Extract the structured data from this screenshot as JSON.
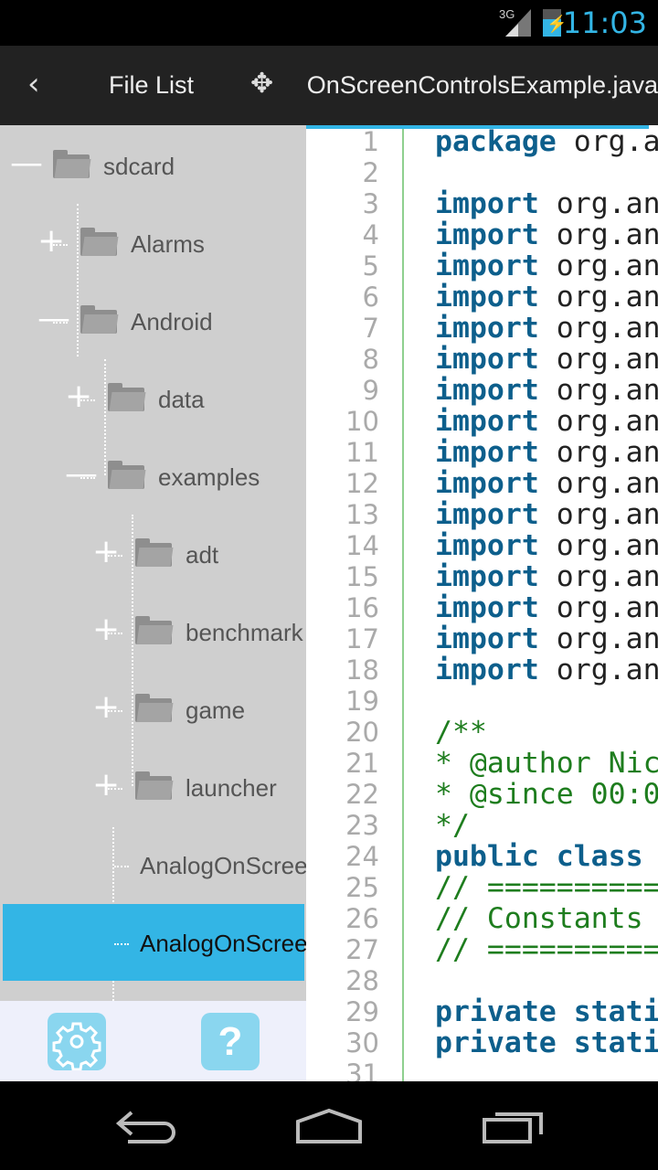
{
  "status": {
    "network": "3G",
    "time": "11:03",
    "battery": 0.7
  },
  "actionbar": {
    "back_icon": "chevron-left-icon",
    "file_list": "File List",
    "move_icon": "move-arrows-icon",
    "tab_title": "AnalogOnScreenControlsExample.java"
  },
  "tree": [
    {
      "label": "sdcard",
      "level": 0,
      "type": "folder",
      "expanded": true
    },
    {
      "label": "Alarms",
      "level": 1,
      "type": "folder",
      "expanded": false
    },
    {
      "label": "Android",
      "level": 1,
      "type": "folder",
      "expanded": true
    },
    {
      "label": "data",
      "level": 2,
      "type": "folder",
      "expanded": false
    },
    {
      "label": "examples",
      "level": 2,
      "type": "folder",
      "expanded": true
    },
    {
      "label": "adt",
      "level": 3,
      "type": "folder",
      "expanded": false
    },
    {
      "label": "benchmark",
      "level": 3,
      "type": "folder",
      "expanded": false
    },
    {
      "label": "game",
      "level": 3,
      "type": "folder",
      "expanded": false
    },
    {
      "label": "launcher",
      "level": 3,
      "type": "folder",
      "expanded": false
    },
    {
      "label": "AnalogOnScreenControlExample.java",
      "level": 3,
      "type": "file"
    },
    {
      "label": "AnalogOnScreenControlsExample.java",
      "level": 3,
      "type": "file",
      "selected": true
    }
  ],
  "bottombar": {
    "settings_icon": "gear-icon",
    "help_icon": "question-icon",
    "help_glyph": "?"
  },
  "colors": {
    "accent": "#33b5e5",
    "keyword": "#0d5f8c",
    "comment": "#1e7d1e"
  },
  "code": [
    [
      [
        "kw",
        "package"
      ],
      [
        "",
        "org.a"
      ]
    ],
    [],
    [
      [
        "kw",
        "import"
      ],
      [
        "",
        "org.an"
      ]
    ],
    [
      [
        "kw",
        "import"
      ],
      [
        "",
        "org.an"
      ]
    ],
    [
      [
        "kw",
        "import"
      ],
      [
        "",
        "org.an"
      ]
    ],
    [
      [
        "kw",
        "import"
      ],
      [
        "",
        "org.an"
      ]
    ],
    [
      [
        "kw",
        "import"
      ],
      [
        "",
        "org.an"
      ]
    ],
    [
      [
        "kw",
        "import"
      ],
      [
        "",
        "org.an"
      ]
    ],
    [
      [
        "kw",
        "import"
      ],
      [
        "",
        "org.an"
      ]
    ],
    [
      [
        "kw",
        "import"
      ],
      [
        "",
        "org.an"
      ]
    ],
    [
      [
        "kw",
        "import"
      ],
      [
        "",
        "org.an"
      ]
    ],
    [
      [
        "kw",
        "import"
      ],
      [
        "",
        "org.an"
      ]
    ],
    [
      [
        "kw",
        "import"
      ],
      [
        "",
        "org.an"
      ]
    ],
    [
      [
        "kw",
        "import"
      ],
      [
        "",
        "org.an"
      ]
    ],
    [
      [
        "kw",
        "import"
      ],
      [
        "",
        "org.an"
      ]
    ],
    [
      [
        "kw",
        "import"
      ],
      [
        "",
        "org.an"
      ]
    ],
    [
      [
        "kw",
        "import"
      ],
      [
        "",
        "org.an"
      ]
    ],
    [
      [
        "kw",
        "import"
      ],
      [
        "",
        "org.an"
      ]
    ],
    [],
    [
      [
        "cm",
        "/**"
      ]
    ],
    [
      [
        "cm",
        "* @author Nic"
      ]
    ],
    [
      [
        "cm",
        "* @since 00:0"
      ]
    ],
    [
      [
        "cm",
        "*/"
      ]
    ],
    [
      [
        "kw",
        "public class"
      ]
    ],
    [
      [
        "cm",
        "// =========="
      ]
    ],
    [
      [
        "cm",
        "// Constants"
      ]
    ],
    [
      [
        "cm",
        "// =========="
      ]
    ],
    [],
    [
      [
        "kw",
        "private stati"
      ]
    ],
    [
      [
        "kw",
        "private stati"
      ]
    ],
    []
  ]
}
